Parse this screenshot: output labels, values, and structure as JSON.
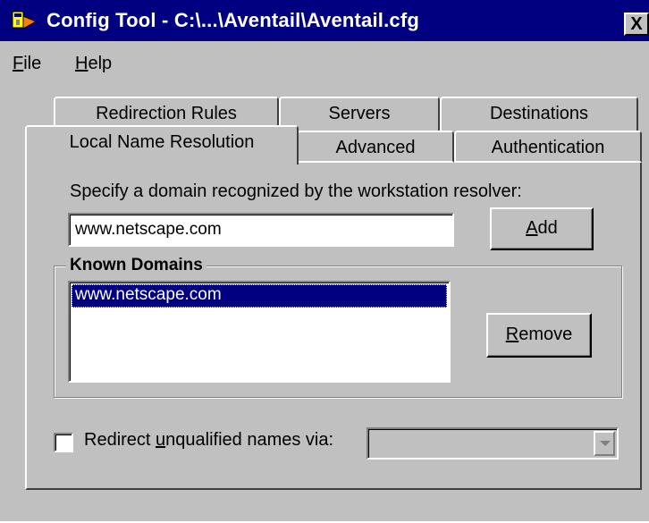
{
  "window": {
    "title": "Config Tool - C:\\...\\Aventail\\Aventail.cfg",
    "close_glyph": "X"
  },
  "menu": {
    "file": {
      "accel": "F",
      "rest": "ile"
    },
    "help": {
      "accel": "H",
      "rest": "elp"
    }
  },
  "tabs": {
    "back_row": [
      "Redirection Rules",
      "Servers",
      "Destinations"
    ],
    "front_row": [
      "Local Name Resolution",
      "Advanced",
      "Authentication"
    ],
    "active": "Local Name Resolution"
  },
  "local_name": {
    "prompt": "Specify a domain recognized by the workstation resolver:",
    "domain_input_value": "www.netscape.com",
    "add_button": {
      "accel": "A",
      "rest": "dd"
    },
    "group_title": "Known Domains",
    "known_domains": [
      "www.netscape.com"
    ],
    "selected_domain": "www.netscape.com",
    "remove_button": {
      "accel": "R",
      "rest": "emove"
    },
    "redirect": {
      "label_prefix": "Redirect ",
      "label_accel": "u",
      "label_rest": "nqualified names via:",
      "checked": false,
      "combo_value": ""
    }
  },
  "colors": {
    "title_bar": "#000080",
    "face": "#c0c0c0",
    "selection": "#000080"
  }
}
